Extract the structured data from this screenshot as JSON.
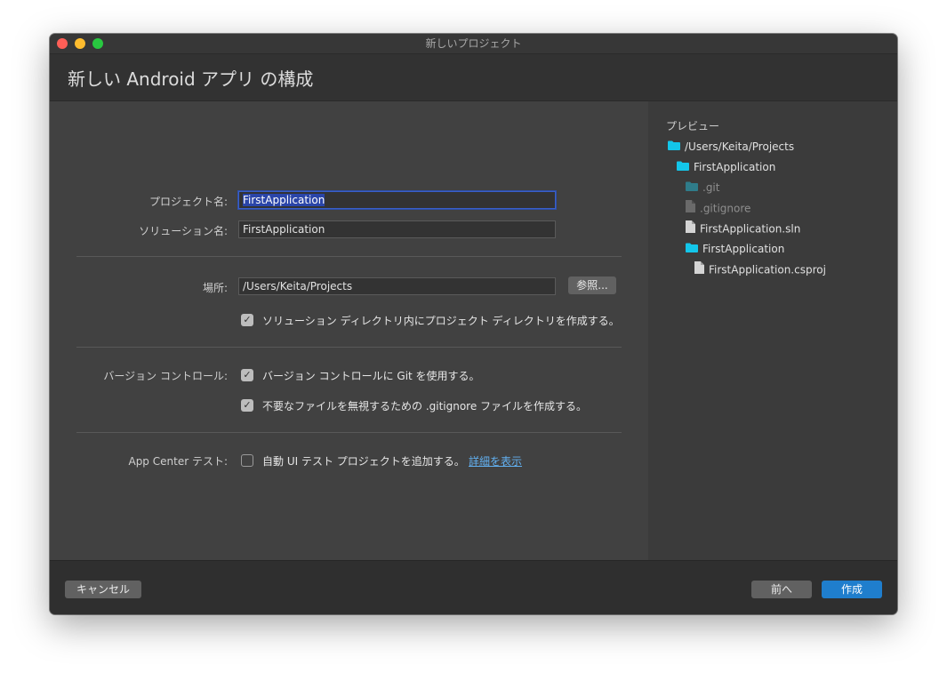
{
  "window": {
    "title": "新しいプロジェクト"
  },
  "header": {
    "title": "新しい Android アプリ の構成"
  },
  "form": {
    "project_name_label": "プロジェクト名:",
    "project_name_value": "FirstApplication",
    "solution_name_label": "ソリューション名:",
    "solution_name_value": "FirstApplication",
    "location_label": "場所:",
    "location_value": "/Users/Keita/Projects",
    "browse_label": "参照...",
    "solution_dir_checkbox": {
      "label": "ソリューション ディレクトリ内にプロジェクト ディレクトリを作成する。",
      "checked": true
    },
    "vcs_label": "バージョン コントロール:",
    "git_checkbox": {
      "label": "バージョン コントロールに Git を使用する。",
      "checked": true
    },
    "gitignore_checkbox": {
      "label": "不要なファイルを無視するための .gitignore ファイルを作成する。",
      "checked": true
    },
    "appcenter_label": "App Center テスト:",
    "uitest_checkbox": {
      "label": "自動 UI テスト プロジェクトを追加する。",
      "checked": false
    },
    "details_link": "詳細を表示"
  },
  "preview": {
    "title": "プレビュー",
    "tree": [
      {
        "name": "/Users/Keita/Projects",
        "icon": "folder-icon",
        "depth": 0,
        "dim": false
      },
      {
        "name": "FirstApplication",
        "icon": "folder-icon",
        "depth": 1,
        "dim": false
      },
      {
        "name": ".git",
        "icon": "folder-icon",
        "depth": 2,
        "dim": true
      },
      {
        "name": ".gitignore",
        "icon": "file-icon",
        "depth": 2,
        "dim": true
      },
      {
        "name": "FirstApplication.sln",
        "icon": "file-icon",
        "depth": 2,
        "dim": false
      },
      {
        "name": "FirstApplication",
        "icon": "folder-icon",
        "depth": 2,
        "dim": false
      },
      {
        "name": "FirstApplication.csproj",
        "icon": "file-icon",
        "depth": 3,
        "dim": false
      }
    ]
  },
  "footer": {
    "cancel_label": "キャンセル",
    "back_label": "前へ",
    "create_label": "作成"
  },
  "colors": {
    "folder": "#13c6ea",
    "folder_dim": "#2f7c8a",
    "file": "#d4d4d4",
    "file_dim": "#6a6a6a",
    "accent": "#1f7ecd",
    "link": "#62b0f0"
  }
}
